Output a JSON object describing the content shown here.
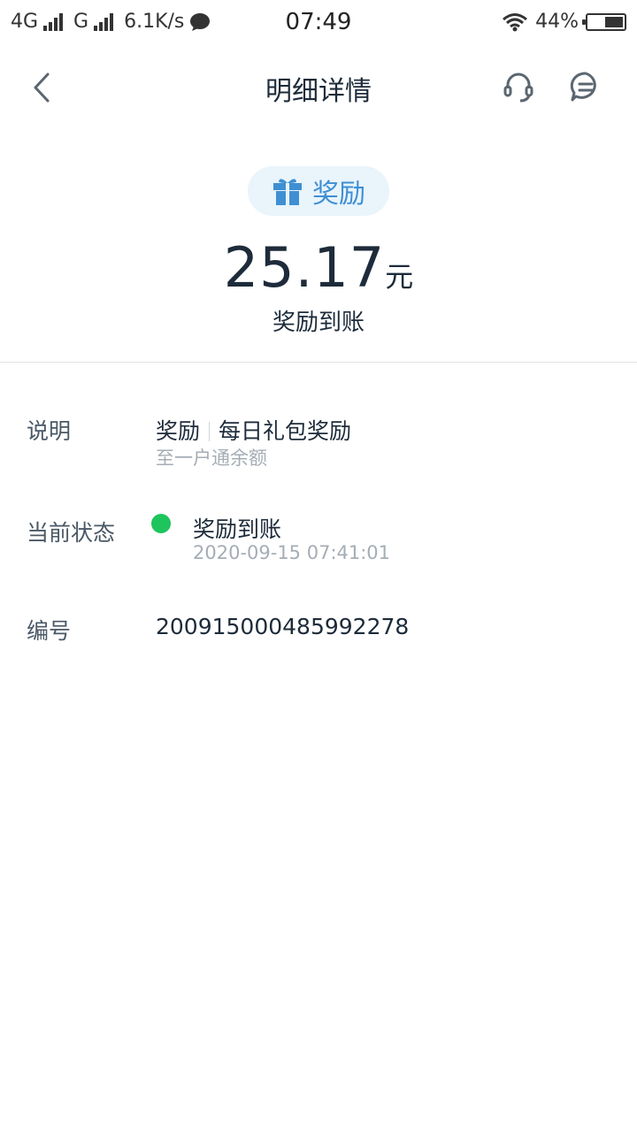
{
  "status_bar": {
    "network_1": "4G",
    "network_2": "G",
    "speed": "6.1K/s",
    "time": "07:49",
    "battery": "44%"
  },
  "nav": {
    "title": "明细详情"
  },
  "summary": {
    "type_label": "奖励",
    "amount": "25.17",
    "unit": "元",
    "status": "奖励到账"
  },
  "details": {
    "description": {
      "label": "说明",
      "category": "奖励",
      "name": "每日礼包奖励",
      "destination": "至一户通余额"
    },
    "current_status": {
      "label": "当前状态",
      "value": "奖励到账",
      "time": "2020-09-15 07:41:01"
    },
    "serial": {
      "label": "编号",
      "value": "200915000485992278"
    }
  },
  "colors": {
    "accent": "#3f8fd3",
    "success": "#1ec45c",
    "pill_bg": "#e9f4fb"
  }
}
